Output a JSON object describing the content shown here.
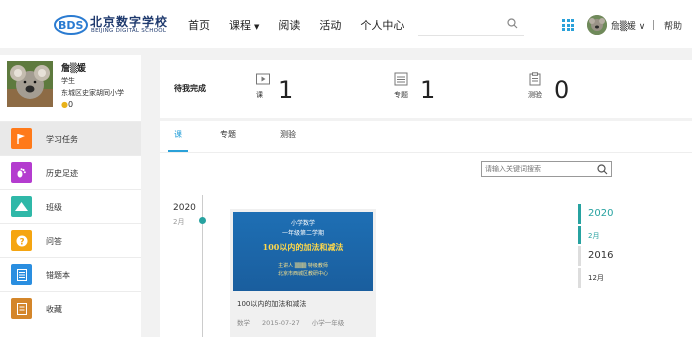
{
  "header": {
    "logo_cn": "北京数字学校",
    "logo_en": "BEIJING DIGITAL SCHOOL",
    "nav": [
      {
        "label": "首页"
      },
      {
        "label": "课程"
      },
      {
        "label": "阅读"
      },
      {
        "label": "活动"
      },
      {
        "label": "个人中心"
      }
    ],
    "user_name": "詹▒媛",
    "help": "帮助"
  },
  "profile": {
    "name": "詹▒媛",
    "role": "学生",
    "school": "东城区史家胡同小学",
    "coins": "0"
  },
  "sidebar": {
    "items": [
      {
        "label": "学习任务",
        "icon": "flag-icon",
        "color": "#ff7a1a"
      },
      {
        "label": "历史足迹",
        "icon": "footprint-icon",
        "color": "#b43ccf"
      },
      {
        "label": "班级",
        "icon": "mountain-icon",
        "color": "#2fb8a8"
      },
      {
        "label": "问答",
        "icon": "question-icon",
        "color": "#f5a511"
      },
      {
        "label": "错题本",
        "icon": "list-icon",
        "color": "#2a8ee0"
      },
      {
        "label": "收藏",
        "icon": "bookmark-icon",
        "color": "#d4862a"
      }
    ]
  },
  "stats": {
    "title": "待我完成",
    "items": [
      {
        "label": "课",
        "value": "1"
      },
      {
        "label": "专题",
        "value": "1"
      },
      {
        "label": "测验",
        "value": "0"
      }
    ]
  },
  "tabs": [
    {
      "label": "课"
    },
    {
      "label": "专题"
    },
    {
      "label": "测验"
    }
  ],
  "search": {
    "placeholder": "请输入关键词搜索"
  },
  "timeline": {
    "year": "2020",
    "month": "2月"
  },
  "card": {
    "image_lines": [
      "小学数学",
      "一年级第二学期",
      "100以内的加法和减法",
      "主讲人 ▒▒▒ 特级教师",
      "北京市西城区教研中心"
    ],
    "title": "100以内的加法和减法",
    "subject": "数学",
    "date": "2015-07-27",
    "grade": "小学一年级"
  },
  "right_timeline": [
    {
      "label": "2020",
      "kind": "year",
      "active": true
    },
    {
      "label": "2月",
      "kind": "month",
      "active": true
    },
    {
      "label": "2016",
      "kind": "year",
      "active": false
    },
    {
      "label": "12月",
      "kind": "month",
      "active": false
    }
  ],
  "colors": {
    "accent": "#2aa1d9",
    "timeline": "#27a2a0"
  }
}
